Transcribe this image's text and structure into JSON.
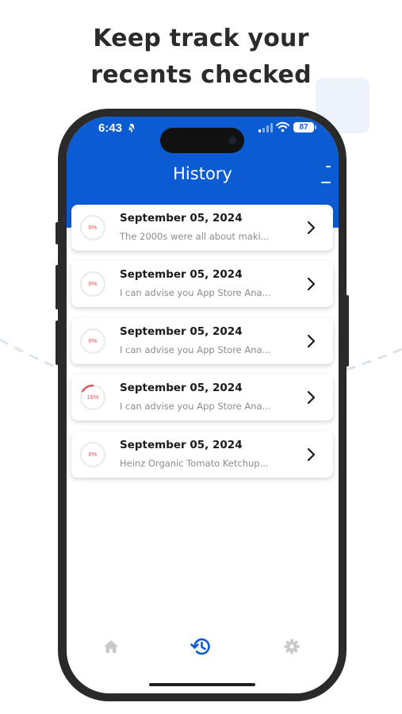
{
  "headline": {
    "line1": "Keep track your",
    "line2": "recents checked"
  },
  "status_bar": {
    "time": "6:43",
    "battery": "87"
  },
  "header": {
    "title": "History"
  },
  "history": [
    {
      "date": "September 05, 2024",
      "preview": "The 2000s were all about maki...",
      "progress_label": "0%",
      "progress": 0
    },
    {
      "date": "September 05, 2024",
      "preview": "I can advise you App Store Ana...",
      "progress_label": "0%",
      "progress": 0
    },
    {
      "date": "September 05, 2024",
      "preview": "I can advise you App Store Ana...",
      "progress_label": "0%",
      "progress": 0
    },
    {
      "date": "September 05, 2024",
      "preview": "I can advise you App Store Ana...",
      "progress_label": "16%",
      "progress": 16
    },
    {
      "date": "September 05, 2024",
      "preview": "Heinz Organic Tomato Ketchup...",
      "progress_label": "0%",
      "progress": 0
    }
  ],
  "tab_bar": {
    "items": [
      {
        "icon": "home-icon",
        "active": false
      },
      {
        "icon": "history-icon",
        "active": true
      },
      {
        "icon": "gear-icon",
        "active": false
      }
    ]
  },
  "colors": {
    "brand_blue": "#0b5bd3",
    "progress_red": "#e05555",
    "inactive_icon": "#c9c9c9"
  }
}
